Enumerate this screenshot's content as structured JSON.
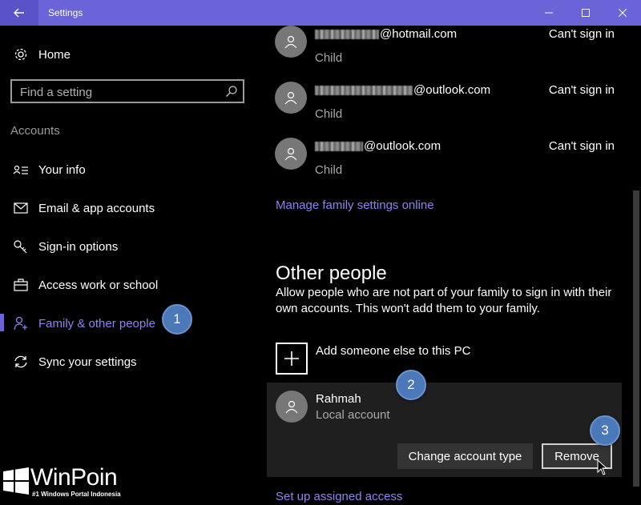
{
  "window": {
    "title": "Settings",
    "accent": "#6b64d9"
  },
  "sidebar": {
    "home_label": "Home",
    "search_placeholder": "Find a setting",
    "section_title": "Accounts",
    "items": [
      {
        "label": "Your info",
        "icon": "person-card-icon"
      },
      {
        "label": "Email & app accounts",
        "icon": "envelope-icon"
      },
      {
        "label": "Sign-in options",
        "icon": "key-icon"
      },
      {
        "label": "Access work or school",
        "icon": "briefcase-icon"
      },
      {
        "label": "Family & other people",
        "icon": "add-person-icon",
        "selected": true
      },
      {
        "label": "Sync your settings",
        "icon": "sync-icon"
      }
    ]
  },
  "content": {
    "family": [
      {
        "email_suffix": "@hotmail.com",
        "role": "Child",
        "status": "Can't sign in"
      },
      {
        "email_suffix": "@outlook.com",
        "role": "Child",
        "status": "Can't sign in"
      },
      {
        "email_suffix": "@outlook.com",
        "role": "Child",
        "status": "Can't sign in"
      }
    ],
    "manage_link": "Manage family settings online",
    "other_people_heading": "Other people",
    "other_people_desc": "Allow people who are not part of your family to sign in with their own accounts. This won't add them to your family.",
    "add_label": "Add someone else to this PC",
    "person": {
      "name": "Rahmah",
      "type": "Local account",
      "change_button": "Change account type",
      "remove_button": "Remove"
    },
    "assigned_access_link": "Set up assigned access"
  },
  "callouts": [
    "1",
    "2",
    "3"
  ],
  "watermark": {
    "brand": "WinPoin",
    "tagline": "#1 Windows Portal Indonesia"
  }
}
